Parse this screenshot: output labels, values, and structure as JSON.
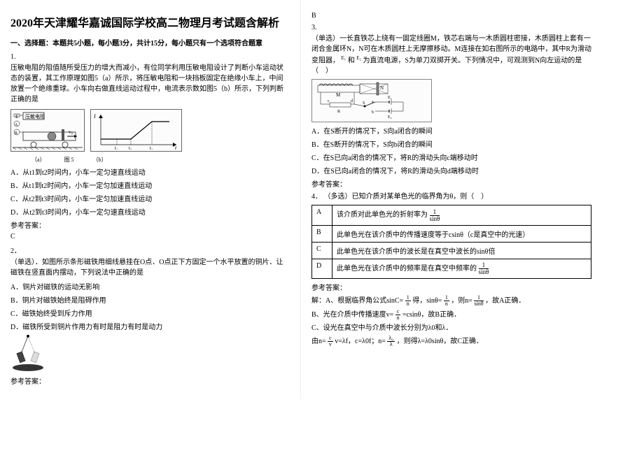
{
  "title": "2020年天津耀华嘉诚国际学校高二物理月考试题含解析",
  "section1": "一、选择题：本题共5小题，每小题3分，共计15分，每小题只有一个选项符合题意",
  "q1": {
    "num": "1.",
    "body": "压敏电阻的阻值随所受压力的增大而减小，有位同学利用压敏电阻设计了判断小车运动状态的装置，其工作原理如图5（a）所示，将压敏电阻和一块挡板固定在绝缘小车上，中间放置一个绝缘重球。小车向右做直线运动过程中，电流表示数如图5（b）所示，下列判断正确的是",
    "fig_label_a": "压敏电阻",
    "fig_label_E": "E",
    "fig_label_A": "A",
    "fig_label_R": "R",
    "fig_label_v0": "v₀",
    "fig_axis_I": "I",
    "fig_axis_t": "t",
    "fig_axis_t1": "t₁",
    "fig_axis_t2": "t₂",
    "fig_axis_t3": "t₃",
    "fig_caption_a": "（a）",
    "fig_caption_b": "（b）",
    "fig_caption": "图 5",
    "optA": "A．从t1到t2时间内，小车一定匀速直线运动",
    "optB": "B．从t1到t2时间内，小车一定匀加速直线运动",
    "optC": "C．从t2到t3时间内，小车一定匀加速直线运动",
    "optD": "D．从t2到t3时间内，小车一定匀速直线运动",
    "ans_label": "参考答案：",
    "ans": "C"
  },
  "q2": {
    "num": "2．",
    "body": "（单选）．如图所示条形磁铁用细线悬挂在O点．O点正下方固定一个水平放置的铜片．让磁铁在竖直面内摆动，下列说法中正确的是",
    "optA": "A．铜片对磁铁的运动无影响",
    "optB": "B．铜片对磁铁始终是阻碍作用",
    "optC": "C．磁铁始终受到斥力作用",
    "optD": "D．磁铁所受到铜片作用力有时是阻力有时是动力",
    "ans_label": "参考答案：",
    "ans": "B"
  },
  "q3": {
    "num": "3.",
    "body1": "（单选）一长直铁芯上绕有一固定线圈M，铁芯右端与一木质圆柱密接，木质圆柱上套有一闭合金属环N，N可在木质圆柱上无摩擦移动。M连接在如右图所示的电路中，其中R为滑动变阻器，",
    "body2": "和",
    "body3": "为直流电源，S为单刀双掷开关。下列情况中，可观测到N向左运动的是（　）",
    "E1": "E₁",
    "E2": "E₂",
    "optA": "A．在S断开的情况下，S向a闭合的瞬间",
    "optB": "B．在S断开的情况下，S向b闭合的瞬间",
    "optC": "C．在S已向a闭合的情况下，将R的滑动头向c端移动时",
    "optD": "D．在S已向a闭合的情况下，将R的滑动头向d端移动时",
    "ans_label": "参考答案："
  },
  "q4": {
    "num": "4．",
    "body": "（多选）已知介质对某单色光的临界角为θ，则（　）",
    "rowA_label": "A",
    "rowA_text": "该介质对此单色光的折射率为",
    "rowA_frac": "1/sinθ",
    "rowB_label": "B",
    "rowB_text": "此单色光在该介质中的传播速度等于csinθ（c是真空中的光速）",
    "rowC_label": "C",
    "rowC_text": "此单色光在该介质中的波长是在真空中波长的sinθ倍",
    "rowD_label": "D",
    "rowD_text": "此单色光在该介质中的频率是在真空中频率的",
    "rowD_frac": "1/sinθ",
    "ans_label": "参考答案：",
    "expA": "解：A、根据临界角公式sinC=",
    "expA2": "得，sinθ=",
    "expA3": "，则n=",
    "expA4": "，故A正确．",
    "expB": "B、光在介质中传播速度v=",
    "expB2": "=csinθ，故B正确．",
    "expC": "C、设光在真空中与介质中波长分别为λ0和λ．",
    "expD1": "由n=",
    "expD2": "  v=λf，c=λ0f；n=",
    "expD3": "，则得λ=λ0sinθ，故C正确．",
    "frac_1n": "1/n",
    "frac_1sin": "1/sinθ",
    "frac_cn": "c/n",
    "frac_cv": "c/v",
    "frac_l0l": "λ₀/λ"
  }
}
